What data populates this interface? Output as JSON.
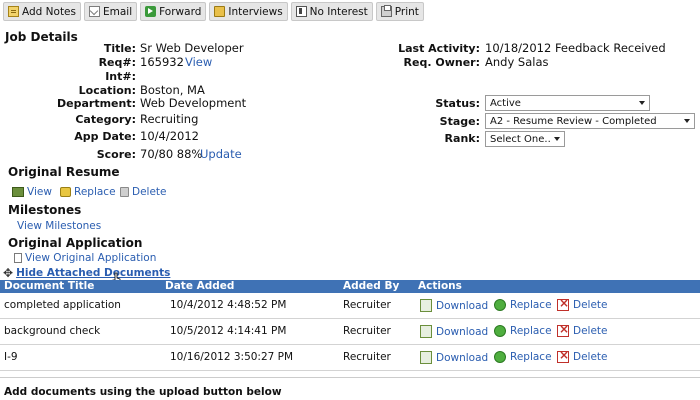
{
  "toolbar": {
    "buttons": [
      {
        "label": "Add Notes",
        "icon": "notes-icon"
      },
      {
        "label": "Email",
        "icon": "email-icon"
      },
      {
        "label": "Forward",
        "icon": "forward-icon"
      },
      {
        "label": "Interviews",
        "icon": "interviews-icon"
      },
      {
        "label": "No Interest",
        "icon": "no-interest-icon"
      },
      {
        "label": "Print",
        "icon": "print-icon"
      }
    ]
  },
  "job_details": {
    "heading": "Job Details",
    "title_label": "Title:",
    "title": "Sr Web Developer",
    "req_label": "Req#:",
    "req": "165932",
    "req_view": "View",
    "int_label": "Int#:",
    "location_label": "Location:",
    "location": "Boston, MA",
    "department_label": "Department:",
    "department": "Web Development",
    "category_label": "Category:",
    "category": "Recruiting",
    "app_date_label": "App Date:",
    "app_date": "10/4/2012",
    "score_label": "Score:",
    "score": "70/80 88%",
    "score_update": "Update",
    "last_activity_label": "Last Activity:",
    "last_activity": "10/18/2012 Feedback Received",
    "req_owner_label": "Req. Owner:",
    "req_owner": "Andy Salas",
    "status_label": "Status:",
    "status": "Active",
    "stage_label": "Stage:",
    "stage": "A2 - Resume Review - Completed",
    "rank_label": "Rank:",
    "rank": "Select One.."
  },
  "original_resume": {
    "heading": "Original Resume",
    "view": "View",
    "replace": "Replace",
    "delete": "Delete"
  },
  "milestones": {
    "heading": "Milestones",
    "view": "View Milestones"
  },
  "original_application": {
    "heading": "Original Application",
    "view": "View Original Application",
    "toggle": "Hide Attached Documents"
  },
  "documents": {
    "headers": [
      "Document Title",
      "Date Added",
      "Added By",
      "Actions"
    ],
    "actions": {
      "download": "Download",
      "replace": "Replace",
      "delete": "Delete"
    },
    "rows": [
      {
        "title": "completed application",
        "date": "10/4/2012 4:48:52 PM",
        "added_by": "Recruiter"
      },
      {
        "title": "background check",
        "date": "10/5/2012 4:14:41 PM",
        "added_by": "Recruiter"
      },
      {
        "title": "I-9",
        "date": "10/16/2012 3:50:27 PM",
        "added_by": "Recruiter"
      }
    ]
  },
  "footer": {
    "note": "Add documents using the upload button below"
  }
}
